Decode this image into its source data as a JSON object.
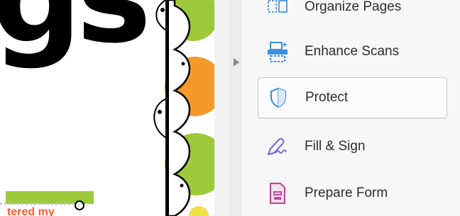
{
  "document": {
    "headline_fragment": "gs",
    "clipped_text": "tered my"
  },
  "tools_pane": {
    "items": [
      {
        "label": "Organize Pages",
        "icon": "organize-pages-icon",
        "color": "#5aa0e6",
        "selected": false
      },
      {
        "label": "Enhance Scans",
        "icon": "enhance-scans-icon",
        "color": "#3d8fe0",
        "selected": false
      },
      {
        "label": "Protect",
        "icon": "shield-icon",
        "color": "#3d8fe0",
        "selected": true
      },
      {
        "label": "Fill & Sign",
        "icon": "fill-sign-pen-icon",
        "color": "#7b6ee0",
        "selected": false
      },
      {
        "label": "Prepare Form",
        "icon": "prepare-form-icon",
        "color": "#c04a9a",
        "selected": false
      }
    ]
  },
  "colors": {
    "dot_green": "#9dc93a",
    "dot_yellow": "#d9e23a",
    "dot_orange": "#f39a2b",
    "accent_blue": "#3d8fe0",
    "selection_border": "#c9c9c9"
  }
}
